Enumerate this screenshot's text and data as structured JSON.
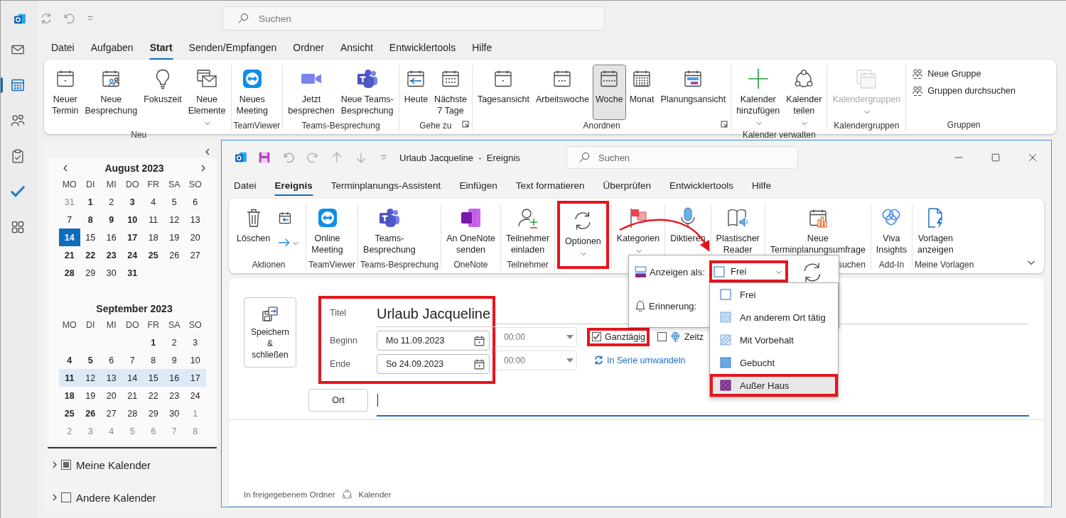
{
  "app": {
    "search": {
      "placeholder": "Suchen"
    }
  },
  "nav_rail": [
    {
      "selected": false
    },
    {
      "selected": true
    },
    {
      "selected": false
    },
    {
      "selected": false
    },
    {
      "selected": false
    },
    {
      "selected": false
    }
  ],
  "menu_tabs": [
    {
      "label": "Datei",
      "selected": false
    },
    {
      "label": "Aufgaben",
      "selected": false
    },
    {
      "label": "Start",
      "selected": true
    },
    {
      "label": "Senden/Empfangen",
      "selected": false
    },
    {
      "label": "Ordner",
      "selected": false
    },
    {
      "label": "Ansicht",
      "selected": false
    },
    {
      "label": "Entwicklertools",
      "selected": false
    },
    {
      "label": "Hilfe",
      "selected": false
    }
  ],
  "ribbon": {
    "groups": [
      {
        "label": "Neu",
        "items": [
          {
            "kind": "large",
            "label": "Neuer\nTermin",
            "dropdown": false,
            "disabled": false
          },
          {
            "kind": "large",
            "label": "Neue\nBesprechung",
            "dropdown": false,
            "disabled": false
          },
          {
            "kind": "large",
            "label": "Fokuszeit",
            "dropdown": false,
            "disabled": false
          },
          {
            "kind": "large",
            "label": "Neue\nElemente",
            "dropdown": true,
            "disabled": false
          }
        ]
      },
      {
        "label": "TeamViewer",
        "items": [
          {
            "kind": "large",
            "label": "Neues\nMeeting",
            "dropdown": false,
            "disabled": false
          }
        ]
      },
      {
        "label": "Teams-Besprechung",
        "items": [
          {
            "kind": "large",
            "label": "Jetzt\nbesprechen",
            "dropdown": false,
            "disabled": false
          },
          {
            "kind": "large",
            "label": "Neue Teams-\nBesprechung",
            "dropdown": false,
            "disabled": false
          }
        ]
      },
      {
        "label": "Gehe zu",
        "launcher": true,
        "items": [
          {
            "kind": "large",
            "label": "Heute",
            "dropdown": false,
            "disabled": false
          },
          {
            "kind": "large",
            "label": "Nächste\n7 Tage",
            "dropdown": false,
            "disabled": false
          }
        ]
      },
      {
        "label": "Anordnen",
        "launcher": true,
        "items": [
          {
            "kind": "large",
            "label": "Tagesansicht",
            "dropdown": false,
            "disabled": false,
            "selected": false
          },
          {
            "kind": "large",
            "label": "Arbeitswoche",
            "dropdown": false,
            "disabled": false,
            "selected": false
          },
          {
            "kind": "large",
            "label": "Woche",
            "dropdown": false,
            "disabled": false,
            "selected": true
          },
          {
            "kind": "large",
            "label": "Monat",
            "dropdown": false,
            "disabled": false,
            "selected": false
          },
          {
            "kind": "large",
            "label": "Planungsansicht",
            "dropdown": false,
            "disabled": false,
            "selected": false
          }
        ]
      },
      {
        "label": "Kalender verwalten",
        "items": [
          {
            "kind": "large",
            "label": "Kalender\nhinzufügen",
            "dropdown": true,
            "disabled": false
          },
          {
            "kind": "large",
            "label": "Kalender\nteilen",
            "dropdown": true,
            "disabled": false
          }
        ]
      },
      {
        "label": "Kalendergruppen",
        "items": [
          {
            "kind": "large",
            "label": "Kalendergruppen",
            "dropdown": true,
            "disabled": true
          }
        ]
      },
      {
        "label": "Gruppen",
        "items": [
          {
            "kind": "small",
            "label": "Neue Gruppe",
            "dropdown": false,
            "disabled": false
          },
          {
            "kind": "small",
            "label": "Gruppen durchsuchen",
            "dropdown": false,
            "disabled": false
          }
        ]
      }
    ]
  },
  "navigation_pane": {
    "months": [
      {
        "title": "August 2023",
        "weekdays": [
          "MO",
          "DI",
          "MI",
          "DO",
          "FR",
          "SA",
          "SO"
        ],
        "weeks": [
          {
            "selected": false,
            "days": [
              {
                "day": "31",
                "muted": true,
                "bold": false,
                "today": false
              },
              {
                "day": "1",
                "muted": false,
                "bold": true,
                "today": false
              },
              {
                "day": "2",
                "muted": false,
                "bold": false,
                "today": false
              },
              {
                "day": "3",
                "muted": false,
                "bold": true,
                "today": false
              },
              {
                "day": "4",
                "muted": false,
                "bold": false,
                "today": false
              },
              {
                "day": "5",
                "muted": false,
                "bold": false,
                "today": false
              },
              {
                "day": "6",
                "muted": false,
                "bold": false,
                "today": false
              }
            ]
          },
          {
            "selected": false,
            "days": [
              {
                "day": "7",
                "muted": false,
                "bold": false,
                "today": false
              },
              {
                "day": "8",
                "muted": false,
                "bold": true,
                "today": false
              },
              {
                "day": "9",
                "muted": false,
                "bold": true,
                "today": false
              },
              {
                "day": "10",
                "muted": false,
                "bold": true,
                "today": false
              },
              {
                "day": "11",
                "muted": false,
                "bold": false,
                "today": false
              },
              {
                "day": "12",
                "muted": false,
                "bold": false,
                "today": false
              },
              {
                "day": "13",
                "muted": false,
                "bold": false,
                "today": false
              }
            ]
          },
          {
            "selected": false,
            "days": [
              {
                "day": "14",
                "muted": false,
                "bold": true,
                "today": true
              },
              {
                "day": "15",
                "muted": false,
                "bold": false,
                "today": false
              },
              {
                "day": "16",
                "muted": false,
                "bold": false,
                "today": false
              },
              {
                "day": "17",
                "muted": false,
                "bold": true,
                "today": false
              },
              {
                "day": "18",
                "muted": false,
                "bold": false,
                "today": false
              },
              {
                "day": "19",
                "muted": false,
                "bold": false,
                "today": false
              },
              {
                "day": "20",
                "muted": false,
                "bold": false,
                "today": false
              }
            ]
          },
          {
            "selected": false,
            "days": [
              {
                "day": "21",
                "muted": false,
                "bold": true,
                "today": false
              },
              {
                "day": "22",
                "muted": false,
                "bold": true,
                "today": false
              },
              {
                "day": "23",
                "muted": false,
                "bold": true,
                "today": false
              },
              {
                "day": "24",
                "muted": false,
                "bold": true,
                "today": false
              },
              {
                "day": "25",
                "muted": false,
                "bold": true,
                "today": false
              },
              {
                "day": "26",
                "muted": false,
                "bold": false,
                "today": false
              },
              {
                "day": "27",
                "muted": false,
                "bold": false,
                "today": false
              }
            ]
          },
          {
            "selected": false,
            "days": [
              {
                "day": "28",
                "muted": false,
                "bold": true,
                "today": false
              },
              {
                "day": "29",
                "muted": false,
                "bold": false,
                "today": false
              },
              {
                "day": "30",
                "muted": false,
                "bold": false,
                "today": false
              },
              {
                "day": "31",
                "muted": false,
                "bold": true,
                "today": false
              }
            ]
          }
        ]
      },
      {
        "title": "September 2023",
        "weekdays": [
          "MO",
          "DI",
          "MI",
          "DO",
          "FR",
          "SA",
          "SO"
        ],
        "weeks": [
          {
            "selected": false,
            "days": [
              {
                "day": "1",
                "muted": false,
                "bold": true,
                "today": false
              },
              {
                "day": "2",
                "muted": false,
                "bold": false,
                "today": false
              },
              {
                "day": "3",
                "muted": false,
                "bold": false,
                "today": false
              }
            ]
          },
          {
            "selected": false,
            "days": [
              {
                "day": "4",
                "muted": false,
                "bold": true,
                "today": false
              },
              {
                "day": "5",
                "muted": false,
                "bold": true,
                "today": false
              },
              {
                "day": "6",
                "muted": false,
                "bold": false,
                "today": false
              },
              {
                "day": "7",
                "muted": false,
                "bold": false,
                "today": false
              },
              {
                "day": "8",
                "muted": false,
                "bold": false,
                "today": false
              },
              {
                "day": "9",
                "muted": false,
                "bold": false,
                "today": false
              },
              {
                "day": "10",
                "muted": false,
                "bold": false,
                "today": false
              }
            ]
          },
          {
            "selected": true,
            "days": [
              {
                "day": "11",
                "muted": false,
                "bold": true,
                "today": false
              },
              {
                "day": "12",
                "muted": false,
                "bold": false,
                "today": false
              },
              {
                "day": "13",
                "muted": false,
                "bold": false,
                "today": false
              },
              {
                "day": "14",
                "muted": false,
                "bold": false,
                "today": false
              },
              {
                "day": "15",
                "muted": false,
                "bold": false,
                "today": false
              },
              {
                "day": "16",
                "muted": false,
                "bold": false,
                "today": false
              },
              {
                "day": "17",
                "muted": false,
                "bold": false,
                "today": false
              }
            ]
          },
          {
            "selected": false,
            "days": [
              {
                "day": "18",
                "muted": false,
                "bold": true,
                "today": false
              },
              {
                "day": "19",
                "muted": false,
                "bold": false,
                "today": false
              },
              {
                "day": "20",
                "muted": false,
                "bold": false,
                "today": false
              },
              {
                "day": "21",
                "muted": false,
                "bold": false,
                "today": false
              },
              {
                "day": "22",
                "muted": false,
                "bold": false,
                "today": false
              },
              {
                "day": "23",
                "muted": false,
                "bold": false,
                "today": false
              },
              {
                "day": "24",
                "muted": false,
                "bold": false,
                "today": false
              }
            ]
          },
          {
            "selected": false,
            "days": [
              {
                "day": "25",
                "muted": false,
                "bold": true,
                "today": false
              },
              {
                "day": "26",
                "muted": false,
                "bold": true,
                "today": false
              },
              {
                "day": "27",
                "muted": false,
                "bold": false,
                "today": false
              },
              {
                "day": "28",
                "muted": false,
                "bold": false,
                "today": false
              },
              {
                "day": "29",
                "muted": false,
                "bold": false,
                "today": false
              },
              {
                "day": "30",
                "muted": false,
                "bold": false,
                "today": false
              },
              {
                "day": "1",
                "muted": true,
                "bold": false,
                "today": false
              }
            ]
          },
          {
            "selected": false,
            "days": [
              {
                "day": "2",
                "muted": true,
                "bold": false,
                "today": false
              },
              {
                "day": "3",
                "muted": true,
                "bold": false,
                "today": false
              },
              {
                "day": "4",
                "muted": true,
                "bold": false,
                "today": false
              },
              {
                "day": "5",
                "muted": true,
                "bold": false,
                "today": false
              },
              {
                "day": "6",
                "muted": true,
                "bold": false,
                "today": false
              },
              {
                "day": "7",
                "muted": true,
                "bold": false,
                "today": false
              },
              {
                "day": "8",
                "muted": true,
                "bold": false,
                "today": false
              }
            ]
          }
        ]
      }
    ],
    "folders": [
      {
        "label": "Meine Kalender",
        "checked": false,
        "indeterminate": true,
        "expanded": false
      },
      {
        "label": "Andere Kalender",
        "checked": false,
        "indeterminate": false,
        "expanded": false
      }
    ]
  },
  "event_window": {
    "title": "Urlaub Jacqueline  -  Ereignis",
    "search": {
      "placeholder": "Suchen"
    },
    "tabs": [
      {
        "label": "Datei",
        "selected": false
      },
      {
        "label": "Ereignis",
        "selected": true
      },
      {
        "label": "Terminplanungs-Assistent",
        "selected": false
      },
      {
        "label": "Einfügen",
        "selected": false
      },
      {
        "label": "Text formatieren",
        "selected": false
      },
      {
        "label": "Überprüfen",
        "selected": false
      },
      {
        "label": "Entwicklertools",
        "selected": false
      },
      {
        "label": "Hilfe",
        "selected": false
      }
    ],
    "ribbon": {
      "groups": [
        {
          "label": "Aktionen",
          "items": [
            {
              "kind": "large",
              "label": "Löschen",
              "dropdown": false
            },
            {
              "kind": "icons",
              "dropdown": true
            }
          ]
        },
        {
          "label": "TeamViewer",
          "items": [
            {
              "kind": "large",
              "label": "Online\nMeeting",
              "dropdown": false
            }
          ]
        },
        {
          "label": "Teams-Besprechung",
          "items": [
            {
              "kind": "large",
              "label": "Teams-\nBesprechung",
              "dropdown": false
            }
          ]
        },
        {
          "label": "OneNote",
          "items": [
            {
              "kind": "large",
              "label": "An OneNote\nsenden",
              "dropdown": false
            }
          ]
        },
        {
          "label": "Teilnehmer",
          "items": [
            {
              "kind": "large",
              "label": "Teilnehmer\neinladen",
              "dropdown": false
            }
          ]
        },
        {
          "items": [
            {
              "kind": "large",
              "label": "Optionen",
              "dropdown": true,
              "highlighted": true
            }
          ]
        },
        {
          "items": [
            {
              "kind": "large",
              "label": "Kategorien",
              "dropdown": true,
              "highlighted": false
            }
          ]
        },
        {
          "items": [
            {
              "kind": "large",
              "label": "Diktieren",
              "dropdown": false,
              "highlighted": false
            }
          ]
        },
        {
          "items": [
            {
              "kind": "large",
              "label": "Plastischer\nReader",
              "dropdown": false,
              "highlighted": false
            }
          ]
        },
        {
          "label": "suchen",
          "items": [
            {
              "kind": "large",
              "label": "Neue\nTerminplanungsumfrage",
              "dropdown": false
            }
          ]
        },
        {
          "label": "Add-In",
          "items": [
            {
              "kind": "large",
              "label": "Viva\nInsights",
              "dropdown": false
            }
          ]
        },
        {
          "label": "Meine Vorlagen",
          "items": [
            {
              "kind": "large",
              "label": "Vorlagen\nanzeigen",
              "dropdown": false
            }
          ]
        }
      ]
    },
    "show_as_popup": {
      "label": "Anzeigen als:",
      "value": "Frei",
      "highlighted": true,
      "reminder_label": "Erinnerung:",
      "options": [
        {
          "label": "Frei",
          "hovered": false,
          "highlighted": false
        },
        {
          "label": "An anderem Ort tätig",
          "hovered": false,
          "highlighted": false
        },
        {
          "label": "Mit Vorbehalt",
          "hovered": false,
          "highlighted": false
        },
        {
          "label": "Gebucht",
          "hovered": false,
          "highlighted": false
        },
        {
          "label": "Außer Haus",
          "hovered": true,
          "highlighted": true
        }
      ]
    },
    "form": {
      "save_button": "Speichern\n&\nschließen",
      "highlighted": true,
      "title": {
        "label": "Titel",
        "value": "Urlaub Jacqueline"
      },
      "start": {
        "label": "Beginn",
        "date": "Mo 11.09.2023",
        "time": "00:00",
        "time_disabled": true
      },
      "end": {
        "label": "Ende",
        "date": "So 24.09.2023",
        "time": "00:00",
        "time_disabled": true
      },
      "all_day": {
        "label": "Ganztägig",
        "checked": true,
        "highlighted": true
      },
      "time_zones": {
        "label": "Zeitz",
        "checked": false
      },
      "recurrence_link": "In Serie umwandeln",
      "location": {
        "button": "Ort",
        "focused": true
      },
      "footer": {
        "folder_label": "In freigegebenem Ordner",
        "folder": "Kalender"
      }
    }
  },
  "annotations": {
    "arrow": true
  }
}
